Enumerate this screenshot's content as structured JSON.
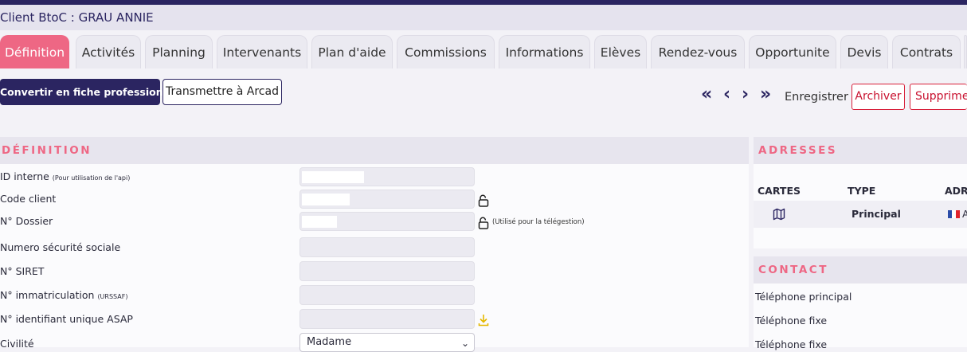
{
  "header": {
    "client_title": "Client BtoC : GRAU ANNIE"
  },
  "tabs": [
    {
      "label": "Définition",
      "active": true
    },
    {
      "label": "Activités"
    },
    {
      "label": "Planning"
    },
    {
      "label": "Intervenants"
    },
    {
      "label": "Plan d'aide"
    },
    {
      "label": "Commissions"
    },
    {
      "label": "Informations"
    },
    {
      "label": "Elèves"
    },
    {
      "label": "Rendez-vous"
    },
    {
      "label": "Opportunite"
    },
    {
      "label": "Devis"
    },
    {
      "label": "Contrats"
    }
  ],
  "toolbar": {
    "convert_label": "Convertir en fiche professionnel",
    "transmit_label": "Transmettre à Arcad",
    "first_icon": "«",
    "prev_icon": "‹",
    "next_icon": "›",
    "last_icon": "»",
    "save_label": "Enregistrer",
    "archive_label": "Archiver",
    "delete_label": "Supprime"
  },
  "definition": {
    "title": "DÉFINITION",
    "fields": [
      {
        "label": "ID interne",
        "note": "(Pour utilisation de l'api)"
      },
      {
        "label": "Code client"
      },
      {
        "label": "N° Dossier",
        "hint": "(Utilisé pour la télégestion)"
      },
      {
        "label": "Numero sécurité sociale"
      },
      {
        "label": "N° SIRET"
      },
      {
        "label": "N° immatriculation",
        "note": "(URSSAF)"
      },
      {
        "label": "N° identifiant unique ASAP"
      },
      {
        "label": "Civilité",
        "value": "Madame"
      }
    ]
  },
  "addresses": {
    "title": "ADRESSES",
    "columns": [
      "CARTES",
      "TYPE",
      "ADR"
    ],
    "rows": [
      {
        "type": "Principal",
        "address": "A"
      }
    ]
  },
  "contact": {
    "title": "CONTACT",
    "labels": [
      "Téléphone principal",
      "Téléphone fixe",
      "Téléphone fixe"
    ]
  },
  "colors": {
    "brand": "#2b2561",
    "accent": "#ee6784",
    "danger": "#c8102e",
    "warning": "#e5b800"
  }
}
